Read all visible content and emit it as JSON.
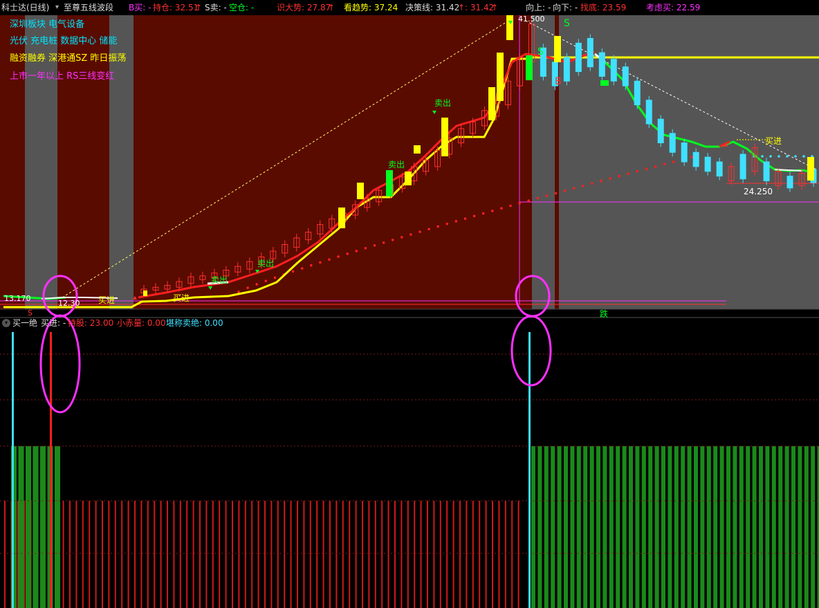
{
  "header": {
    "stock_name": "科士达(日线)",
    "indicator_name": "至尊五线波段",
    "b_buy": "B买: -",
    "position": "持仓: 32.51",
    "s_sell": "S卖: -",
    "empty": "空仓: -",
    "big_trend": "识大势: 27.87",
    "look_trend": "看趋势: 37.24",
    "decision": "决策线: 31.42",
    "decision2": ": 31.42",
    "up": "向上: -",
    "down": "向下: -",
    "bottom": "找底: 23.59",
    "consider_buy": "考虑买: 22.59"
  },
  "info_lines": [
    {
      "text": "深圳板块 电气设备",
      "color": "#00e5ff"
    },
    {
      "text": "光伏 充电桩 数据中心 储能",
      "color": "#00e5ff"
    },
    {
      "text": "融资融券 深港通SZ 昨日振荡",
      "color": "#ffff00"
    },
    {
      "text": "上市一年以上 RS三线变红",
      "color": "#ff30ff"
    }
  ],
  "price_labels": {
    "low_left": "13.170",
    "low_left2": "12.30",
    "high": "41.500",
    "low_right": "24.250"
  },
  "signals": {
    "sell": "卖出",
    "buy": "买进",
    "s": "S",
    "b": "B",
    "fall": "跌"
  },
  "sub_header": {
    "name": "买一绝",
    "buy_in": "买进: -",
    "hold": "持股: 23.00",
    "small_volume": "小赤量: 0.00",
    "sell_signal": "堪称卖绝: 0.00"
  },
  "colors": {
    "bg_red": "#5a0b00",
    "bg_gray": "#555555",
    "up_candle": "#ff3030",
    "down_candle": "#40e0ff",
    "yellow": "#ffff00",
    "green": "#00ff00",
    "magenta": "#ff30ff"
  },
  "chart_data": [
    {
      "type": "candlestick",
      "title": "科士达(日线)",
      "ylim": [
        12,
        42
      ],
      "notable_values": {
        "high": 41.5,
        "low_start": 13.17,
        "low_end": 24.25,
        "trend_line": 31.42
      },
      "candles_approx": [
        [
          13.2,
          13.6
        ],
        [
          13.5,
          13.8
        ],
        [
          13.6,
          14.0
        ],
        [
          13.8,
          14.4
        ],
        [
          14.2,
          14.9
        ],
        [
          14.6,
          15.0
        ],
        [
          14.8,
          15.3
        ],
        [
          15.0,
          15.6
        ],
        [
          15.4,
          16.0
        ],
        [
          15.7,
          16.5
        ],
        [
          16.2,
          17.0
        ],
        [
          16.8,
          17.6
        ],
        [
          17.4,
          18.3
        ],
        [
          18.0,
          19.0
        ],
        [
          18.8,
          19.6
        ],
        [
          19.4,
          20.4
        ],
        [
          20.0,
          21.0
        ],
        [
          20.8,
          21.6
        ],
        [
          21.4,
          22.5
        ],
        [
          22.2,
          23.2
        ],
        [
          22.8,
          24.0
        ],
        [
          23.6,
          24.6
        ],
        [
          24.2,
          25.4
        ],
        [
          25.0,
          26.5
        ],
        [
          26.0,
          27.2
        ],
        [
          26.5,
          28.2
        ],
        [
          27.8,
          29.5
        ],
        [
          29.0,
          30.5
        ],
        [
          30.0,
          31.2
        ],
        [
          30.8,
          32.4
        ],
        [
          31.8,
          33.8
        ],
        [
          33.0,
          35.5
        ],
        [
          35.0,
          38.0
        ],
        [
          37.5,
          41.5
        ],
        [
          36.0,
          39.0
        ],
        [
          35.0,
          37.5
        ],
        [
          35.5,
          38.0
        ],
        [
          36.5,
          39.5
        ],
        [
          37.0,
          40.0
        ],
        [
          36.0,
          38.5
        ],
        [
          35.5,
          37.8
        ],
        [
          35.0,
          37.0
        ],
        [
          33.0,
          35.5
        ],
        [
          31.0,
          33.5
        ],
        [
          29.0,
          31.5
        ],
        [
          28.0,
          30.0
        ],
        [
          27.0,
          29.0
        ],
        [
          26.5,
          28.0
        ],
        [
          26.0,
          27.5
        ],
        [
          25.5,
          27.0
        ],
        [
          25.0,
          26.5
        ],
        [
          25.2,
          27.8
        ],
        [
          26.0,
          28.5
        ],
        [
          25.0,
          27.0
        ],
        [
          24.5,
          26.0
        ],
        [
          24.25,
          25.5
        ],
        [
          24.5,
          25.8
        ],
        [
          24.8,
          26.2
        ]
      ]
    },
    {
      "type": "bar",
      "title": "买一绝",
      "values_approx": {
        "hold": 23.0,
        "small_volume": 0.0,
        "sell_signal": 0.0
      }
    }
  ]
}
